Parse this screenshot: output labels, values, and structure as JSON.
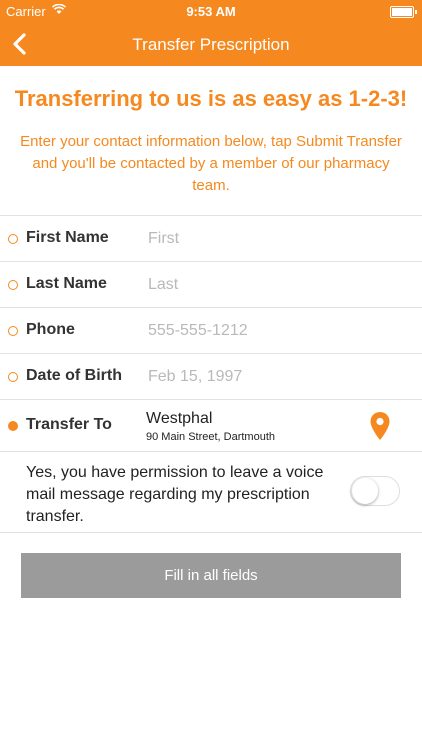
{
  "status_bar": {
    "carrier": "Carrier",
    "time": "9:53 AM"
  },
  "nav": {
    "title": "Transfer Prescription"
  },
  "headline": "Transferring to us is as easy as 1-2-3!",
  "intro": "Enter your contact information below, tap Submit Transfer and you'll be contacted by a member of our pharmacy team.",
  "form": {
    "first_name": {
      "label": "First Name",
      "placeholder": "First",
      "value": ""
    },
    "last_name": {
      "label": "Last Name",
      "placeholder": "Last",
      "value": ""
    },
    "phone": {
      "label": "Phone",
      "placeholder": "555-555-1212",
      "value": ""
    },
    "dob": {
      "label": "Date of Birth",
      "placeholder": "Feb 15, 1997",
      "value": ""
    },
    "transfer_to": {
      "label": "Transfer To",
      "pharmacy_name": "Westphal",
      "pharmacy_address": "90 Main Street, Dartmouth"
    }
  },
  "permission": {
    "text": "Yes, you have permission to leave a voice mail message regarding my prescription transfer.",
    "enabled": false
  },
  "submit_label": "Fill in all fields",
  "colors": {
    "brand": "#F5891F",
    "disabled_button": "#9B9B9B"
  }
}
